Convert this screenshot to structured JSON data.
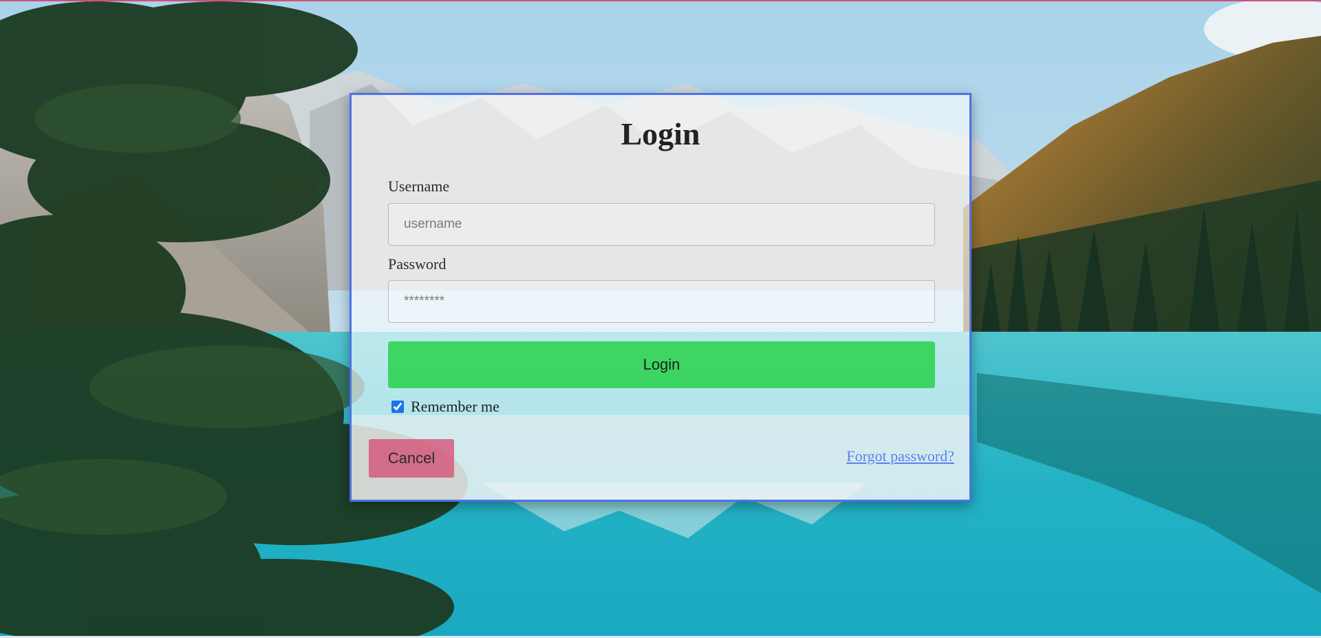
{
  "page": {
    "title": "Login"
  },
  "form": {
    "username_label": "Username",
    "username_placeholder": "username",
    "username_value": "",
    "password_label": "Password",
    "password_placeholder": "********",
    "password_value": "",
    "login_button_label": "Login",
    "remember_me_label": "Remember me",
    "remember_me_checked": true,
    "cancel_button_label": "Cancel",
    "forgot_password_label": "Forgot password?"
  },
  "colors": {
    "card_border": "#4c72e8",
    "login_button": "#2bd350",
    "cancel_button": "#d6446e",
    "link": "#5a82f0",
    "top_accent": "#d0517c"
  },
  "background": {
    "description_icon": "mountain-lake-photo"
  }
}
